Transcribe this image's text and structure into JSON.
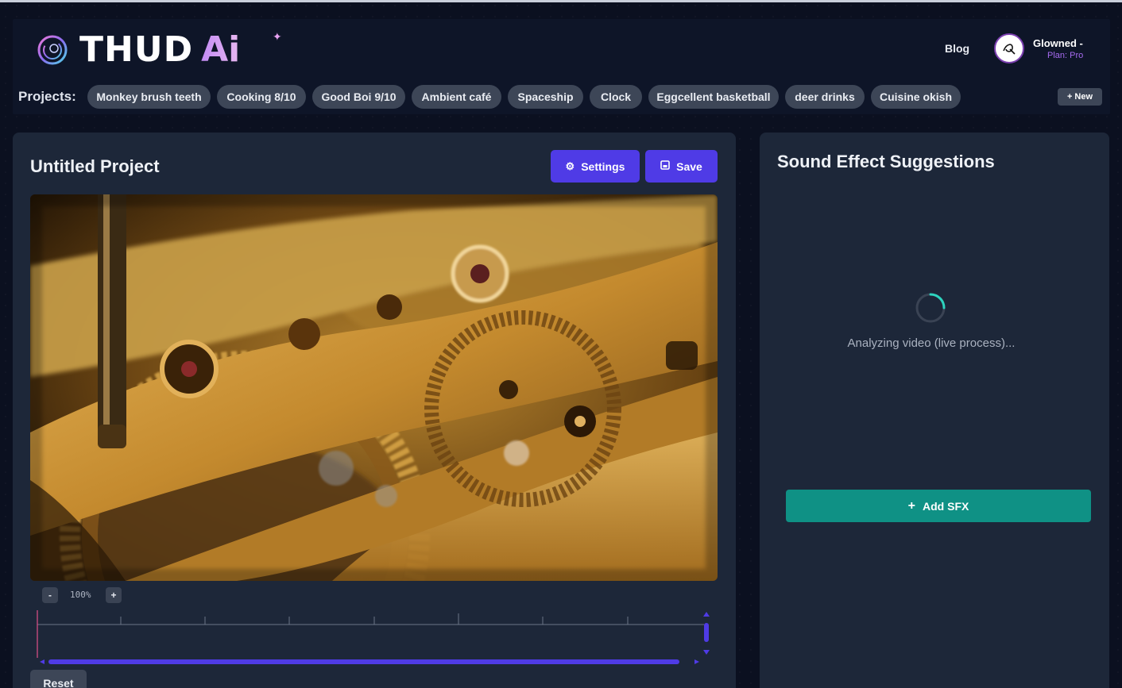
{
  "header": {
    "logo_text": "THUD",
    "logo_ai": "Ai",
    "nav_blog": "Blog",
    "user_name": "Glowned -",
    "user_plan": "Plan: Pro"
  },
  "projects": {
    "label": "Projects:",
    "items": [
      "Monkey brush teeth",
      "Cooking 8/10",
      "Good Boi 9/10",
      "Ambient café",
      "Spaceship",
      "Clock",
      "Eggcellent basketball",
      "deer drinks",
      "Cuisine okish"
    ],
    "new_label": "+ New"
  },
  "editor": {
    "title": "Untitled Project",
    "settings_label": "Settings",
    "save_label": "Save",
    "zoom_minus": "-",
    "zoom_level": "100%",
    "zoom_plus": "+",
    "reset_label": "Reset"
  },
  "sfx": {
    "title": "Sound Effect Suggestions",
    "status": "Analyzing video (live process)...",
    "add_label": "Add SFX",
    "add_icon": "+"
  },
  "colors": {
    "accent": "#4f3be6",
    "teal": "#0f9185",
    "chip_bg": "#3d4657",
    "panel_bg": "#1d2739",
    "page_bg": "#0b1020"
  }
}
